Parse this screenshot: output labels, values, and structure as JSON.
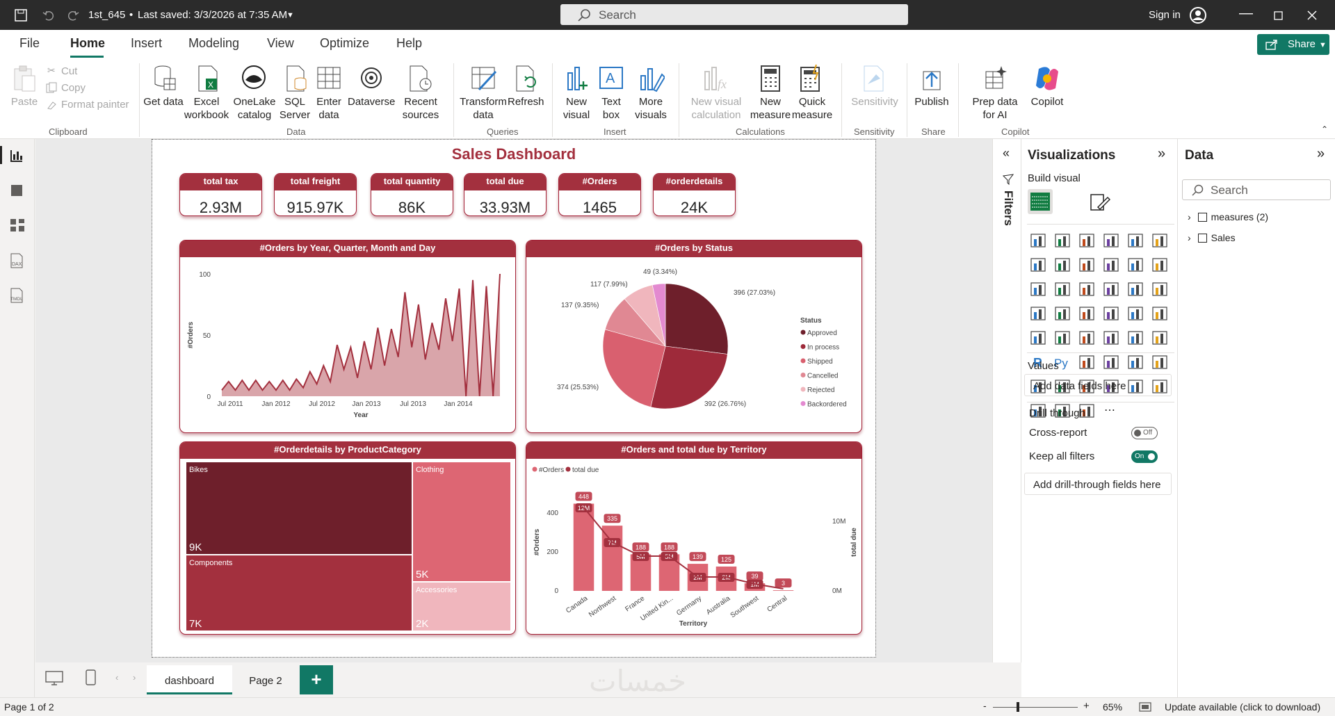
{
  "titlebar": {
    "filename": "1st_645",
    "saved": "Last saved: 3/3/2026 at 7:35 AM",
    "search_placeholder": "Search",
    "signin": "Sign in"
  },
  "menu": [
    "File",
    "Home",
    "Insert",
    "Modeling",
    "View",
    "Optimize",
    "Help"
  ],
  "share_label": "Share",
  "ribbon": {
    "clipboard": {
      "paste": "Paste",
      "cut": "Cut",
      "copy": "Copy",
      "format_painter": "Format painter",
      "group": "Clipboard"
    },
    "data": {
      "get_data": "Get data",
      "excel": "Excel workbook",
      "onelake": "OneLake catalog",
      "sql": "SQL Server",
      "enter": "Enter data",
      "dataverse": "Dataverse",
      "recent": "Recent sources",
      "group": "Data"
    },
    "queries": {
      "transform": "Transform data",
      "refresh": "Refresh",
      "group": "Queries"
    },
    "insert": {
      "new_visual": "New visual",
      "text_box": "Text box",
      "more_visuals": "More visuals",
      "group": "Insert"
    },
    "calculations": {
      "new_visual_calc": "New visual calculation",
      "new_measure": "New measure",
      "quick_measure": "Quick measure",
      "group": "Calculations"
    },
    "sensitivity": {
      "label": "Sensitivity",
      "group": "Sensitivity"
    },
    "share": {
      "publish": "Publish",
      "group": "Share"
    },
    "copilot": {
      "prep": "Prep data for AI",
      "copilot": "Copilot",
      "group": "Copilot"
    }
  },
  "dashboard": {
    "title": "Sales Dashboard",
    "kpis": [
      {
        "label": "total tax",
        "value": "2.93M"
      },
      {
        "label": "total freight",
        "value": "915.97K"
      },
      {
        "label": "total quantity",
        "value": "86K"
      },
      {
        "label": "total due",
        "value": "33.93M"
      },
      {
        "label": "#Orders",
        "value": "1465"
      },
      {
        "label": "#orderdetails",
        "value": "24K"
      }
    ],
    "area_title": "#Orders by Year, Quarter, Month and Day",
    "pie_title": "#Orders by Status",
    "treemap_title": "#Orderdetails by ProductCategory",
    "combo_title": "#Orders and total due by Territory"
  },
  "chart_data": [
    {
      "type": "area",
      "title": "#Orders by Year, Quarter, Month and Day",
      "xlabel": "Year",
      "ylabel": "#Orders",
      "ylim": [
        0,
        100
      ],
      "yticks": [
        "100",
        "50",
        "0"
      ],
      "xticks": [
        "Jul 2011",
        "Jan 2012",
        "Jul 2012",
        "Jan 2013",
        "Jul 2013",
        "Jan 2014"
      ],
      "values": [
        5,
        12,
        5,
        13,
        5,
        13,
        5,
        12,
        5,
        13,
        5,
        14,
        7,
        20,
        10,
        25,
        12,
        42,
        22,
        40,
        15,
        45,
        22,
        56,
        25,
        55,
        32,
        85,
        40,
        75,
        30,
        60,
        38,
        80,
        45,
        88,
        0,
        95,
        0,
        90,
        0,
        100
      ],
      "color": "#a3303e"
    },
    {
      "type": "pie",
      "title": "#Orders by Status",
      "legend_title": "Status",
      "legend_position": "right",
      "categories": [
        "Approved",
        "In process",
        "Shipped",
        "Cancelled",
        "Rejected",
        "Backordered"
      ],
      "slices": [
        {
          "label": "396 (27.03%)",
          "value": 396,
          "color": "#6e1f2b"
        },
        {
          "label": "392 (26.76%)",
          "value": 392,
          "color": "#9e2a3a"
        },
        {
          "label": "374 (25.53%)",
          "value": 374,
          "color": "#d9606f"
        },
        {
          "label": "137 (9.35%)",
          "value": 137,
          "color": "#e08893"
        },
        {
          "label": "117 (7.99%)",
          "value": 117,
          "color": "#f0b6bd"
        },
        {
          "label": "49 (3.34%)",
          "value": 49,
          "color": "#e38ad0"
        }
      ]
    },
    {
      "type": "treemap",
      "title": "#Orderdetails by ProductCategory",
      "categories": [
        "Bikes",
        "Components",
        "Clothing",
        "Accessories"
      ],
      "values": [
        "9K",
        "7K",
        "5K",
        "2K"
      ],
      "colors": [
        "#6e1f2b",
        "#a3303e",
        "#dd6673",
        "#f0b6bd"
      ]
    },
    {
      "type": "bar",
      "title": "#Orders and total due by Territory",
      "xlabel": "Territory",
      "ylabel": "#Orders",
      "y2label": "total due",
      "series": [
        {
          "name": "#Orders",
          "values": [
            448,
            335,
            188,
            188,
            139,
            125,
            39,
            3
          ],
          "color": "#dd6673"
        },
        {
          "name": "total due",
          "values": [
            "12M",
            "7M",
            "5M",
            "5M",
            "2M",
            "2M",
            "1M",
            ""
          ],
          "color": "#a3303e"
        }
      ],
      "categories": [
        "Canada",
        "Northwest",
        "France",
        "United Kin...",
        "Germany",
        "Australia",
        "Southwest",
        "Central"
      ],
      "yticks": [
        "400",
        "200",
        "0"
      ],
      "y2ticks": [
        "10M",
        "0M"
      ],
      "due_values": [
        12,
        7,
        5,
        5,
        2,
        2,
        1,
        0.3
      ],
      "ylim": [
        0,
        500
      ],
      "y2lim": [
        0,
        14
      ]
    }
  ],
  "vispane": {
    "title": "Visualizations",
    "build": "Build visual",
    "values": "Values",
    "add_fields": "Add data fields here",
    "drill": "Drill through",
    "cross": "Cross-report",
    "cross_state": "Off",
    "keep": "Keep all filters",
    "keep_state": "On",
    "add_drill": "Add drill-through fields here"
  },
  "filters_label": "Filters",
  "datapane": {
    "title": "Data",
    "search": "Search",
    "tables": [
      "measures (2)",
      "Sales"
    ]
  },
  "tabs": [
    "dashboard",
    "Page 2"
  ],
  "status": {
    "page": "Page 1 of 2",
    "zoom": "65%",
    "update": "Update available (click to download)"
  },
  "watermark": "خمسات"
}
